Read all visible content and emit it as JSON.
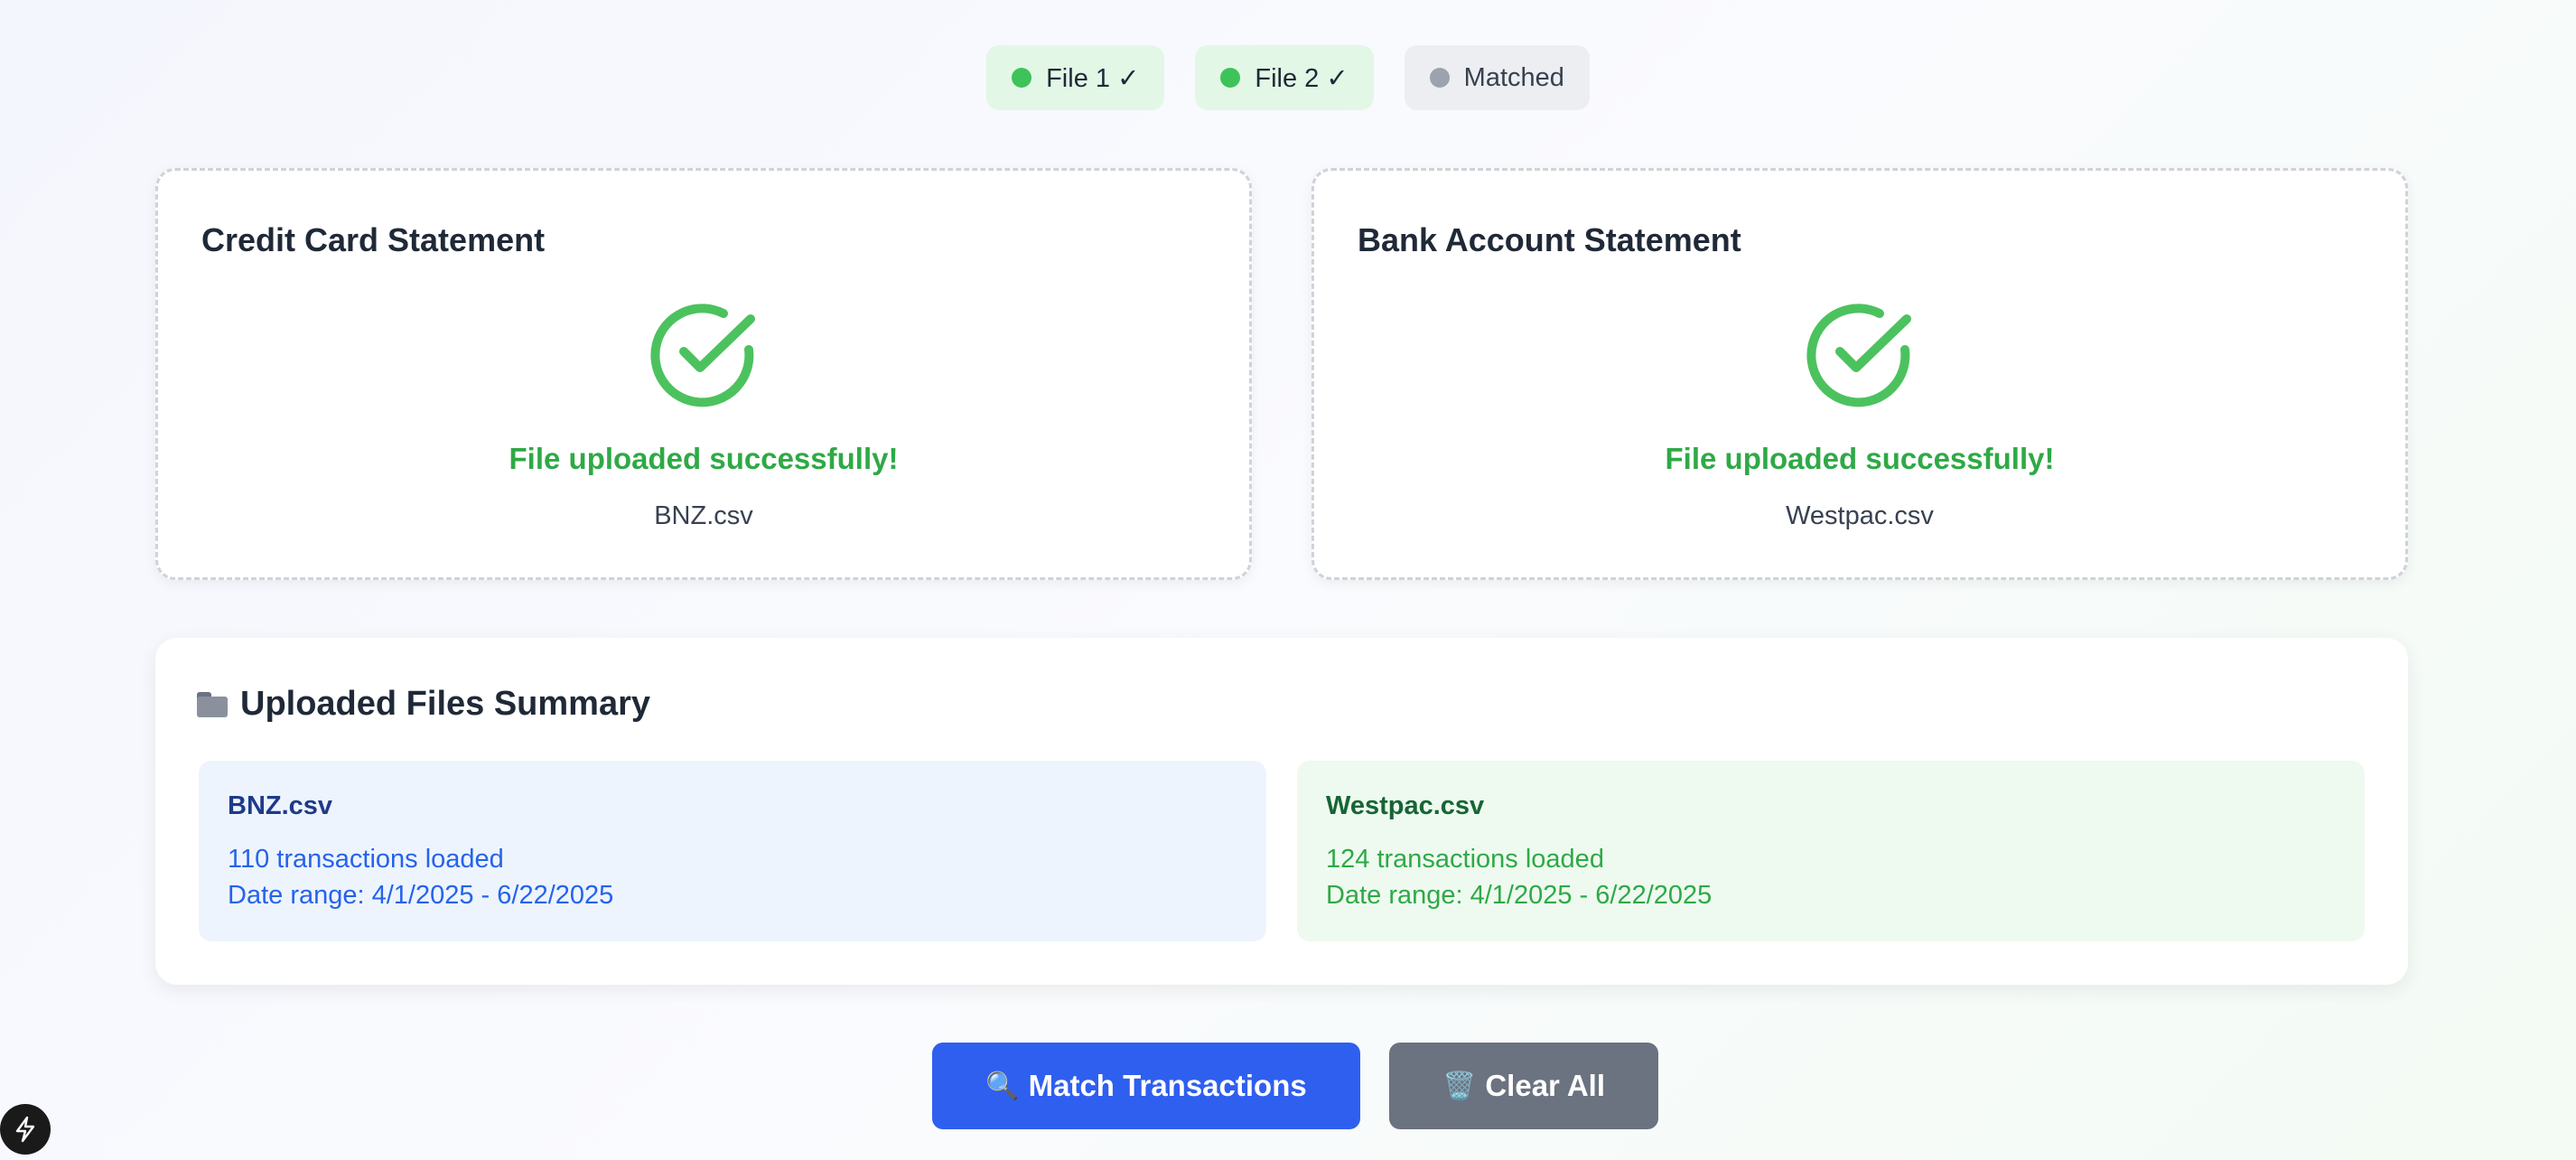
{
  "steps": [
    {
      "label": "File 1 ✓",
      "status": "done"
    },
    {
      "label": "File 2 ✓",
      "status": "done"
    },
    {
      "label": "Matched",
      "status": "pending"
    }
  ],
  "cards": {
    "left": {
      "title": "Credit Card Statement",
      "message": "File uploaded successfully!",
      "file": "BNZ.csv"
    },
    "right": {
      "title": "Bank Account Statement",
      "message": "File uploaded successfully!",
      "file": "Westpac.csv"
    }
  },
  "summary": {
    "title": "Uploaded Files Summary",
    "files": [
      {
        "name": "BNZ.csv",
        "count": "110 transactions loaded",
        "range": "Date range: 4/1/2025 - 6/22/2025"
      },
      {
        "name": "Westpac.csv",
        "count": "124 transactions loaded",
        "range": "Date range: 4/1/2025 - 6/22/2025"
      }
    ]
  },
  "actions": {
    "match_label": "Match Transactions",
    "match_icon": "🔍",
    "clear_label": "Clear All",
    "clear_icon": "🗑️"
  },
  "colors": {
    "success_green": "#2fa946",
    "primary_blue": "#2f5fef",
    "neutral_gray": "#6b7280"
  }
}
